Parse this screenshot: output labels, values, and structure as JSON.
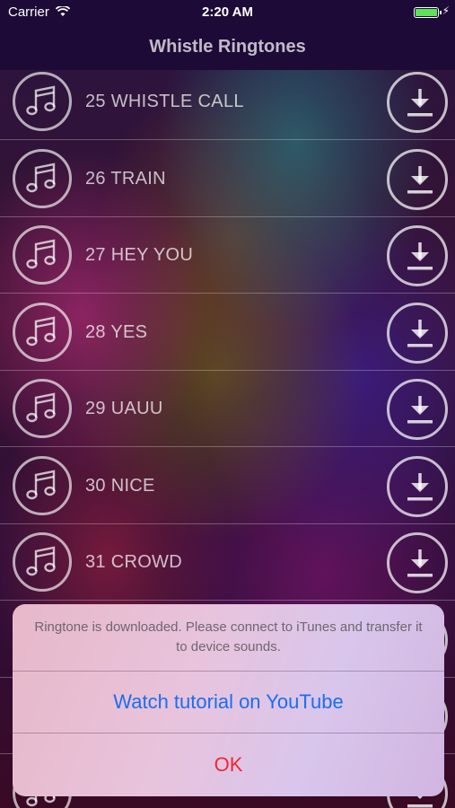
{
  "status_bar": {
    "carrier": "Carrier",
    "time": "2:20 AM",
    "battery_color": "#5ee05b"
  },
  "nav": {
    "title": "Whistle Ringtones"
  },
  "ringtones": [
    {
      "label": "25 WHISTLE CALL"
    },
    {
      "label": "26 TRAIN"
    },
    {
      "label": "27 HEY YOU"
    },
    {
      "label": "28 YES"
    },
    {
      "label": "29 UAUU"
    },
    {
      "label": "30 NICE"
    },
    {
      "label": "31 CROWD"
    }
  ],
  "icons": {
    "row_left": "music-note-icon",
    "row_right": "download-icon"
  },
  "alert": {
    "message": "Ringtone is downloaded. Please connect to iTunes and transfer it to device sounds.",
    "primary_button": "Watch tutorial on YouTube",
    "cancel_button": "OK",
    "primary_color": "#1a6ef0",
    "cancel_color": "#f02830"
  }
}
